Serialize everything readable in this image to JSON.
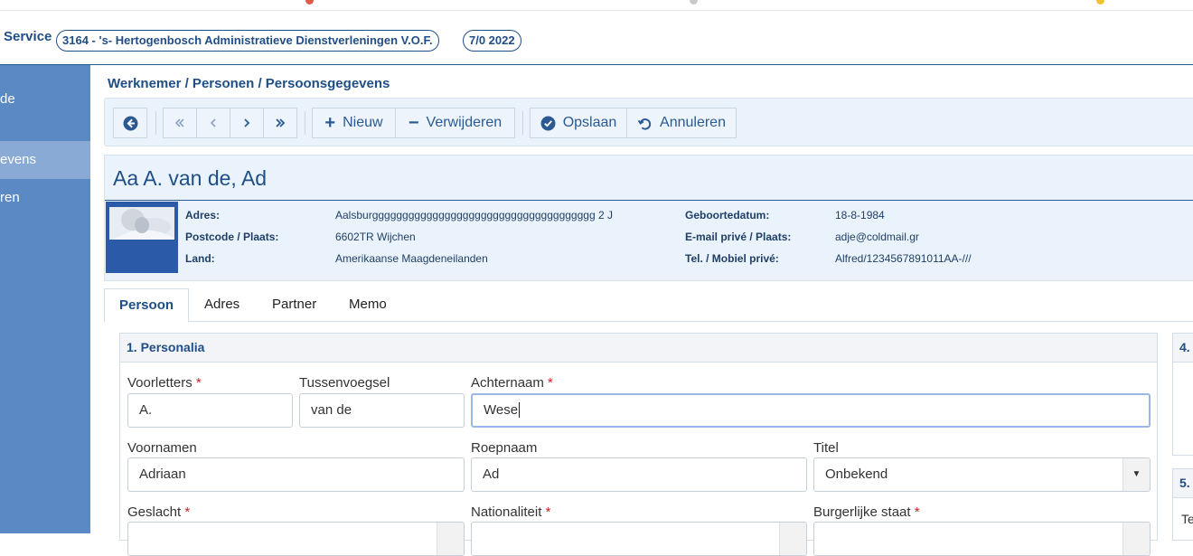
{
  "header": {
    "brand": "Service",
    "company": "3164 - 's- Hertogenbosch Administratieve Dienstverleningen V.O.F.",
    "period": "7/0 2022"
  },
  "sidebar": {
    "items": [
      {
        "label": "de"
      },
      {
        "label": "evens"
      },
      {
        "label": "ren"
      }
    ]
  },
  "breadcrumb": "Werknemer / Personen / Persoonsgegevens",
  "toolbar": {
    "new_label": "Nieuw",
    "delete_label": "Verwijderen",
    "save_label": "Opslaan",
    "cancel_label": "Annuleren"
  },
  "person": {
    "name": "Aa A. van de, Ad",
    "labels": {
      "address": "Adres:",
      "postcode": "Postcode / Plaats:",
      "country": "Land:",
      "birthdate": "Geboortedatum:",
      "email": "E-mail privé / Plaats:",
      "phone": "Tel. / Mobiel privé:"
    },
    "address": "Aalsburggggggggggggggggggggggggggggggggggggg 2 J",
    "postcode": "6602TR Wijchen",
    "country": "Amerikaanse Maagdeneilanden",
    "birthdate": "18-8-1984",
    "email": "adje@coldmail.gr",
    "phone": "Alfred/1234567891011AA-///"
  },
  "tabs": [
    {
      "label": "Persoon"
    },
    {
      "label": "Adres"
    },
    {
      "label": "Partner"
    },
    {
      "label": "Memo"
    }
  ],
  "personalia": {
    "title": "1. Personalia",
    "required_mark": "*",
    "voorletters": {
      "label": "Voorletters",
      "value": "A."
    },
    "tussenvoegsel": {
      "label": "Tussenvoegsel",
      "value": "van de"
    },
    "achternaam": {
      "label": "Achternaam",
      "value": "Wese"
    },
    "voornamen": {
      "label": "Voornamen",
      "value": "Adriaan"
    },
    "roepnaam": {
      "label": "Roepnaam",
      "value": "Ad"
    },
    "titel": {
      "label": "Titel",
      "value": "Onbekend"
    },
    "geslacht": {
      "label": "Geslacht"
    },
    "nationaliteit": {
      "label": "Nationaliteit"
    },
    "burgerlijke_staat": {
      "label": "Burgerlijke staat"
    }
  },
  "right_cards": {
    "card4": "4.",
    "card5": "5.",
    "card5_label": "Te"
  }
}
